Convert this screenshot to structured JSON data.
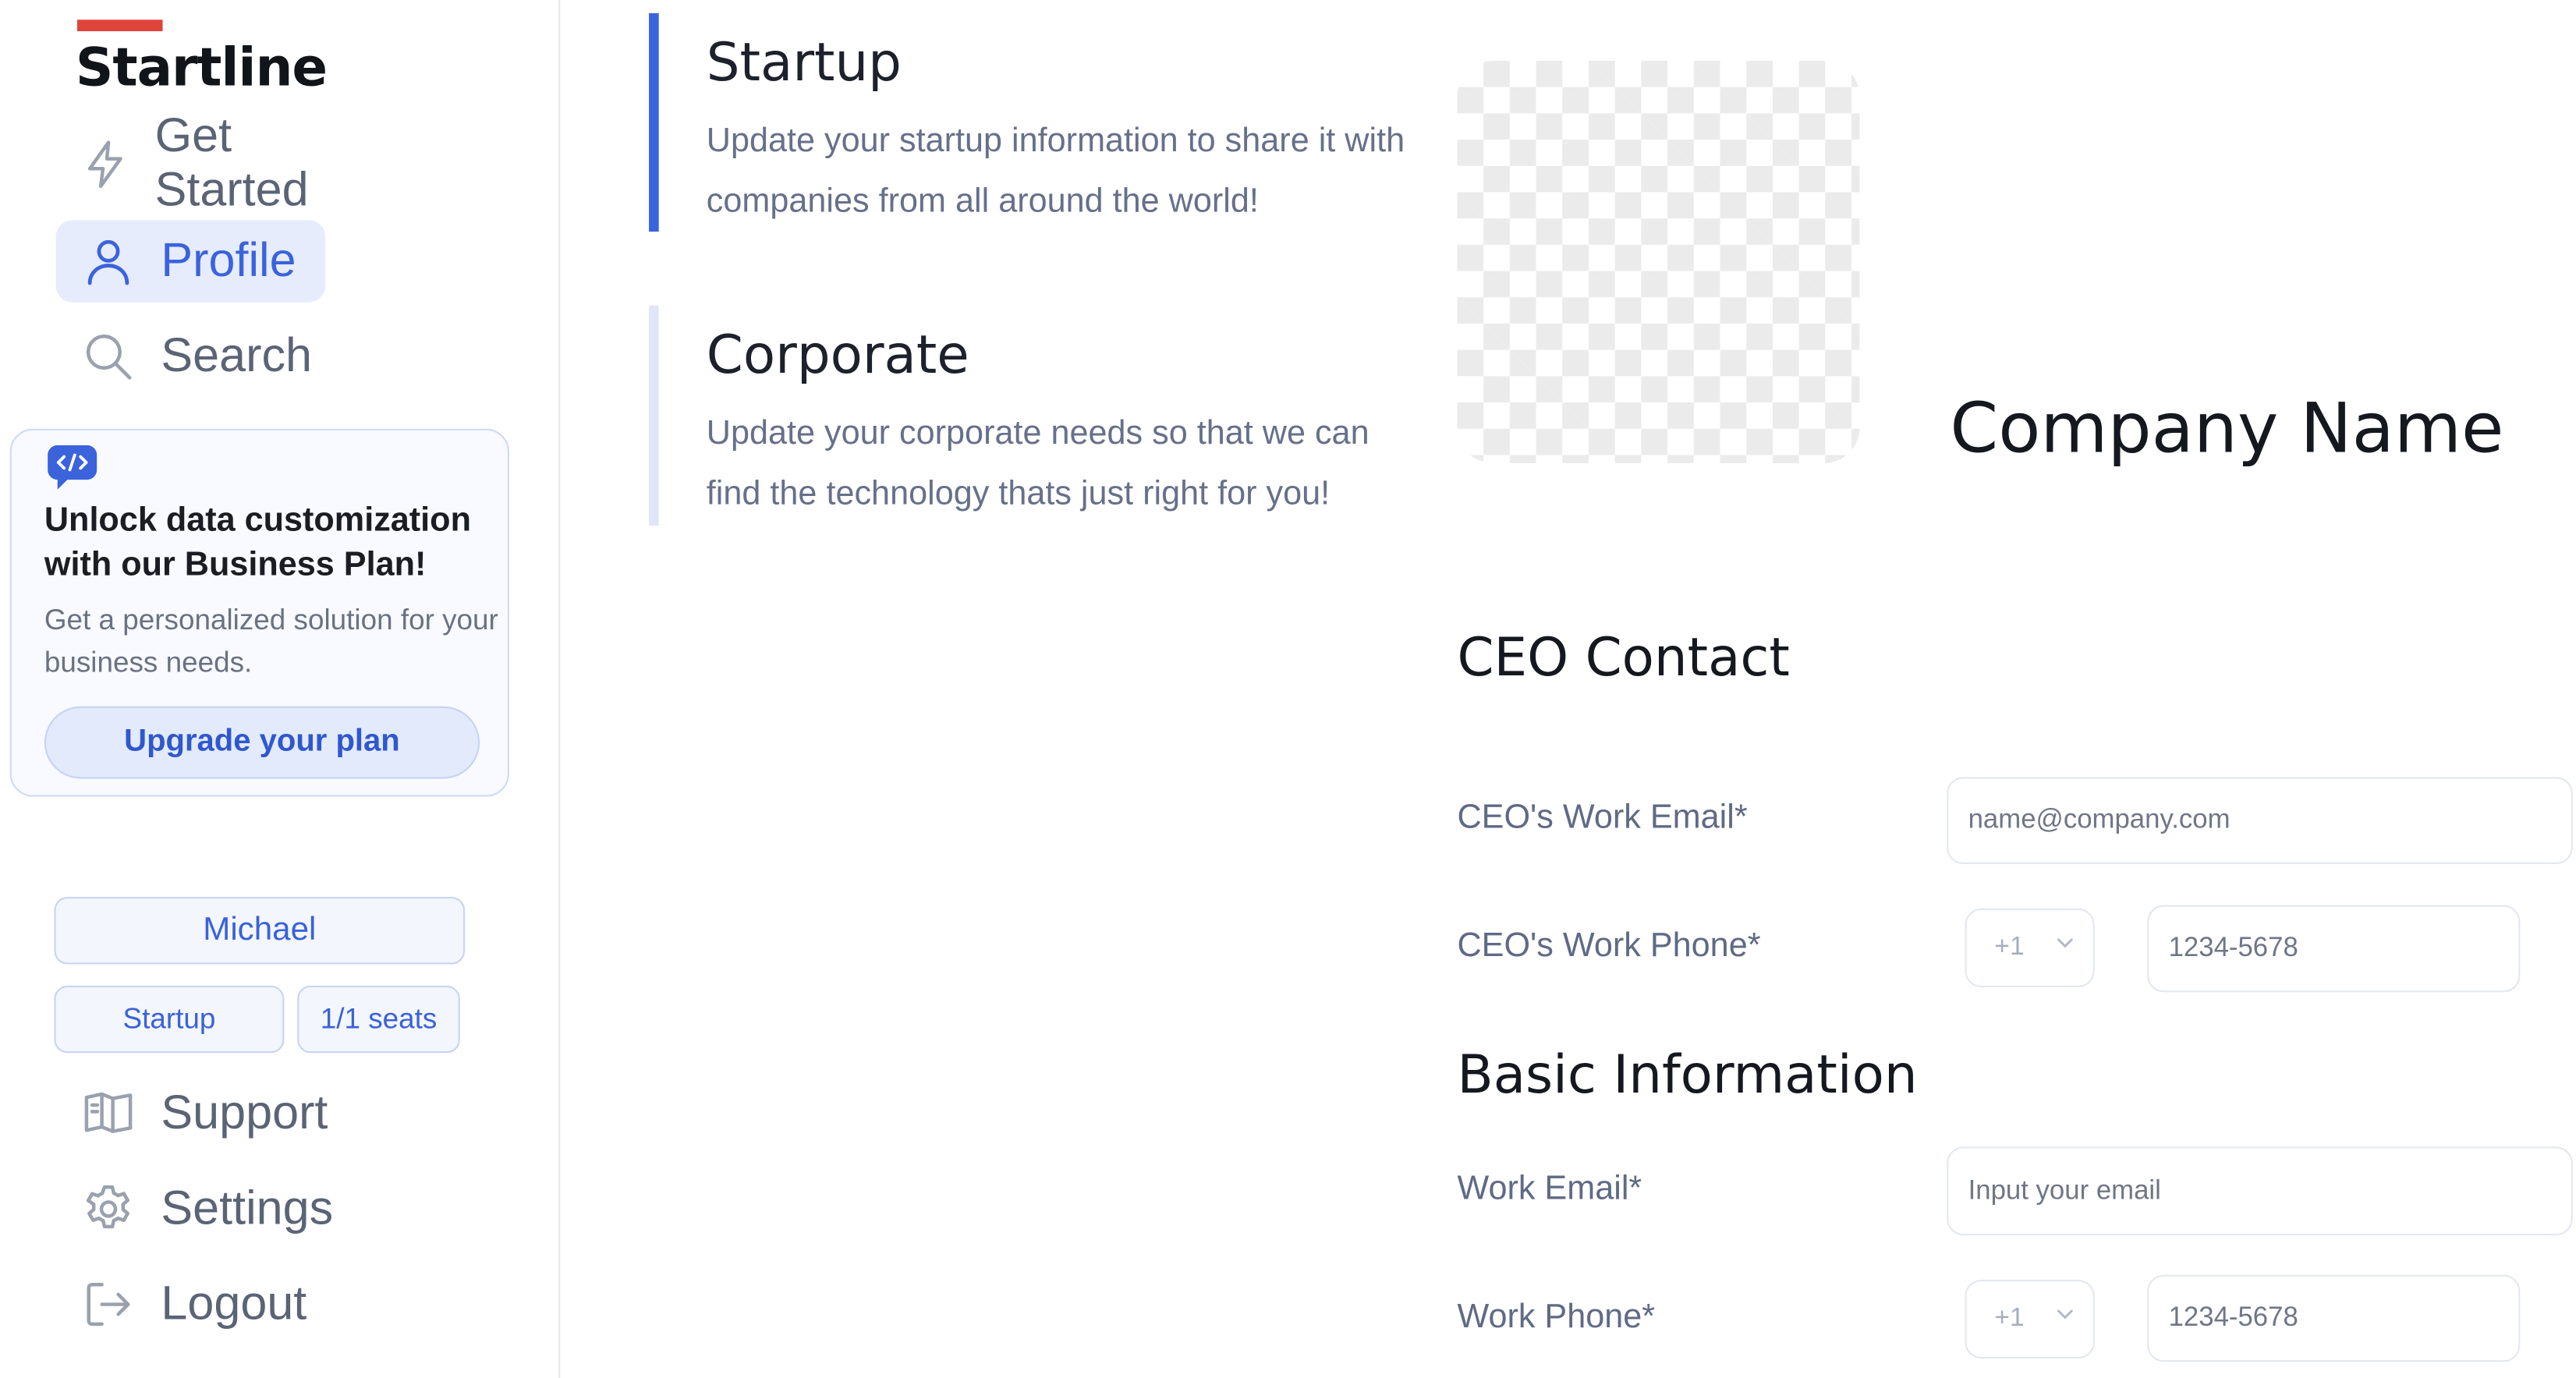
{
  "brand": {
    "name": "Startline",
    "accent": "#e0433a"
  },
  "sidebar": {
    "nav": [
      {
        "label": "Get Started",
        "icon": "lightning-icon",
        "active": false
      },
      {
        "label": "Profile",
        "icon": "user-icon",
        "active": true
      },
      {
        "label": "Search",
        "icon": "search-icon",
        "active": false
      }
    ],
    "promo": {
      "icon": "code-chat-icon",
      "title": "Unlock data customization with our Business Plan!",
      "text": "Get a personalized solution for your business needs.",
      "button": "Upgrade your plan"
    },
    "account": {
      "user": "Michael",
      "plan": "Startup",
      "seats": "1/1 seats"
    },
    "footer_nav": [
      {
        "label": "Support",
        "icon": "book-icon"
      },
      {
        "label": "Settings",
        "icon": "gear-icon"
      },
      {
        "label": "Logout",
        "icon": "logout-icon"
      }
    ]
  },
  "sections": [
    {
      "title": "Startup",
      "description": "Update your startup information to share it with companies from all around the world!",
      "active": true
    },
    {
      "title": "Corporate",
      "description": "Update your corporate needs so that we can find the technology thats just right for you!",
      "active": false
    }
  ],
  "profile": {
    "company_name": "Company Name",
    "ceo_contact": {
      "heading": "CEO Contact",
      "email_label": "CEO's Work Email*",
      "email_placeholder": "name@company.com",
      "phone_label": "CEO's Work Phone*",
      "phone_code": "+1",
      "phone_placeholder": "1234-5678"
    },
    "basic_info": {
      "heading": "Basic Information",
      "email_label": "Work Email*",
      "email_placeholder": "Input your email",
      "phone_label": "Work Phone*",
      "phone_code": "+1",
      "phone_placeholder": "1234-5678"
    }
  },
  "colors": {
    "primary": "#3b63dc",
    "active_bg": "#e6ecfc",
    "muted_text": "#5b6475"
  }
}
